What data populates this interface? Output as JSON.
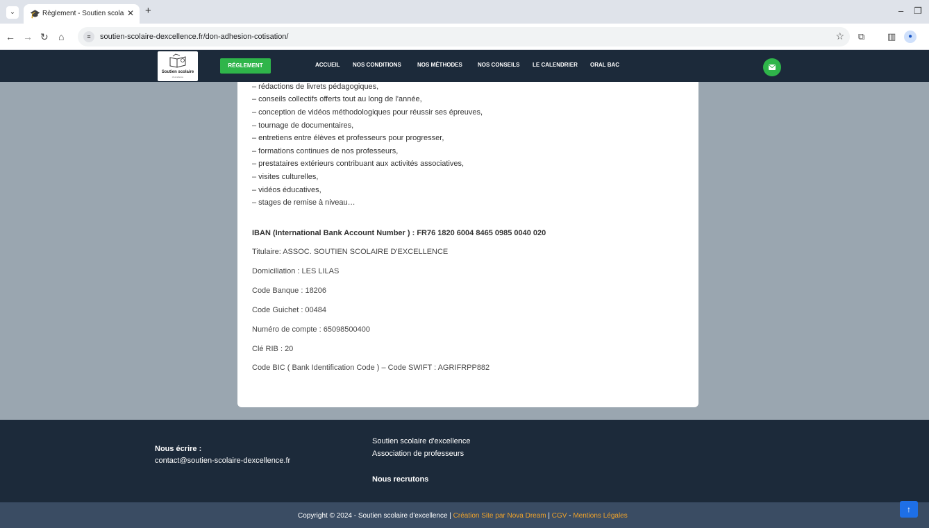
{
  "browser": {
    "tab_title": "Règlement - Soutien scolaire d'",
    "url": "soutien-scolaire-dexcellence.fr/don-adhesion-cotisation/"
  },
  "icons": {
    "tab_dropdown": "chevron-down-icon",
    "favicon": "graduation-cap-icon",
    "close": "close-icon",
    "new_tab": "plus-icon",
    "back": "back-arrow-icon",
    "forward": "forward-arrow-icon",
    "reload": "reload-icon",
    "home": "home-icon",
    "site_info": "site-settings-icon",
    "bookmark": "star-icon",
    "extensions": "puzzle-icon",
    "side_panel": "side-panel-icon",
    "profile": "profile-icon",
    "menu": "kebab-menu-icon",
    "mail": "envelope-icon",
    "scroll_top": "arrow-up-icon"
  },
  "header": {
    "logo_text": "Soutien scolaire",
    "logo_sub": "d'excellence",
    "cta": "RÉGLEMENT",
    "nav": [
      "ACCUEIL",
      "NOS CONDITIONS",
      "NOS MÉTHODES",
      "NOS CONSEILS",
      "LE CALENDRIER",
      "ORAL BAC"
    ]
  },
  "content": {
    "list": [
      "– rédactions de livrets pédagogiques,",
      "– conseils collectifs offerts tout au long de l'année,",
      "– conception de vidéos méthodologiques pour réussir ses épreuves,",
      "– tournage de documentaires,",
      "– entretiens entre élèves et professeurs pour progresser,",
      "– formations continues de nos professeurs,",
      "– prestataires extérieurs contribuant aux activités associatives,",
      "– visites culturelles,",
      "– vidéos éducatives,",
      "– stages de remise à niveau…"
    ],
    "iban": "IBAN (International Bank Account Number ) : FR76 1820 6004 8465 0985 0040 020",
    "details": [
      "Titulaire: ASSOC. SOUTIEN SCOLAIRE D'EXCELLENCE",
      "Domiciliation : LES LILAS",
      "Code Banque : 18206",
      "Code Guichet : 00484",
      "Numéro de compte : 65098500400",
      "Clé RIB : 20",
      "Code BIC ( Bank Identification Code ) – Code SWIFT : AGRIFRPP882"
    ]
  },
  "footer": {
    "contact_title": "Nous écrire :",
    "contact_email": "contact@soutien-scolaire-dexcellence.fr",
    "org_name": "Soutien scolaire d'excellence",
    "org_desc": "Association de professeurs",
    "recruit": "Nous recrutons",
    "copyright_prefix": "Copyright © 2024 - Soutien scolaire d'excellence | ",
    "credit_link": "Création Site par Nova Dream",
    "sep1": " | ",
    "cgv": "CGV",
    "sep2": " - ",
    "legal": "Mentions Légales"
  }
}
